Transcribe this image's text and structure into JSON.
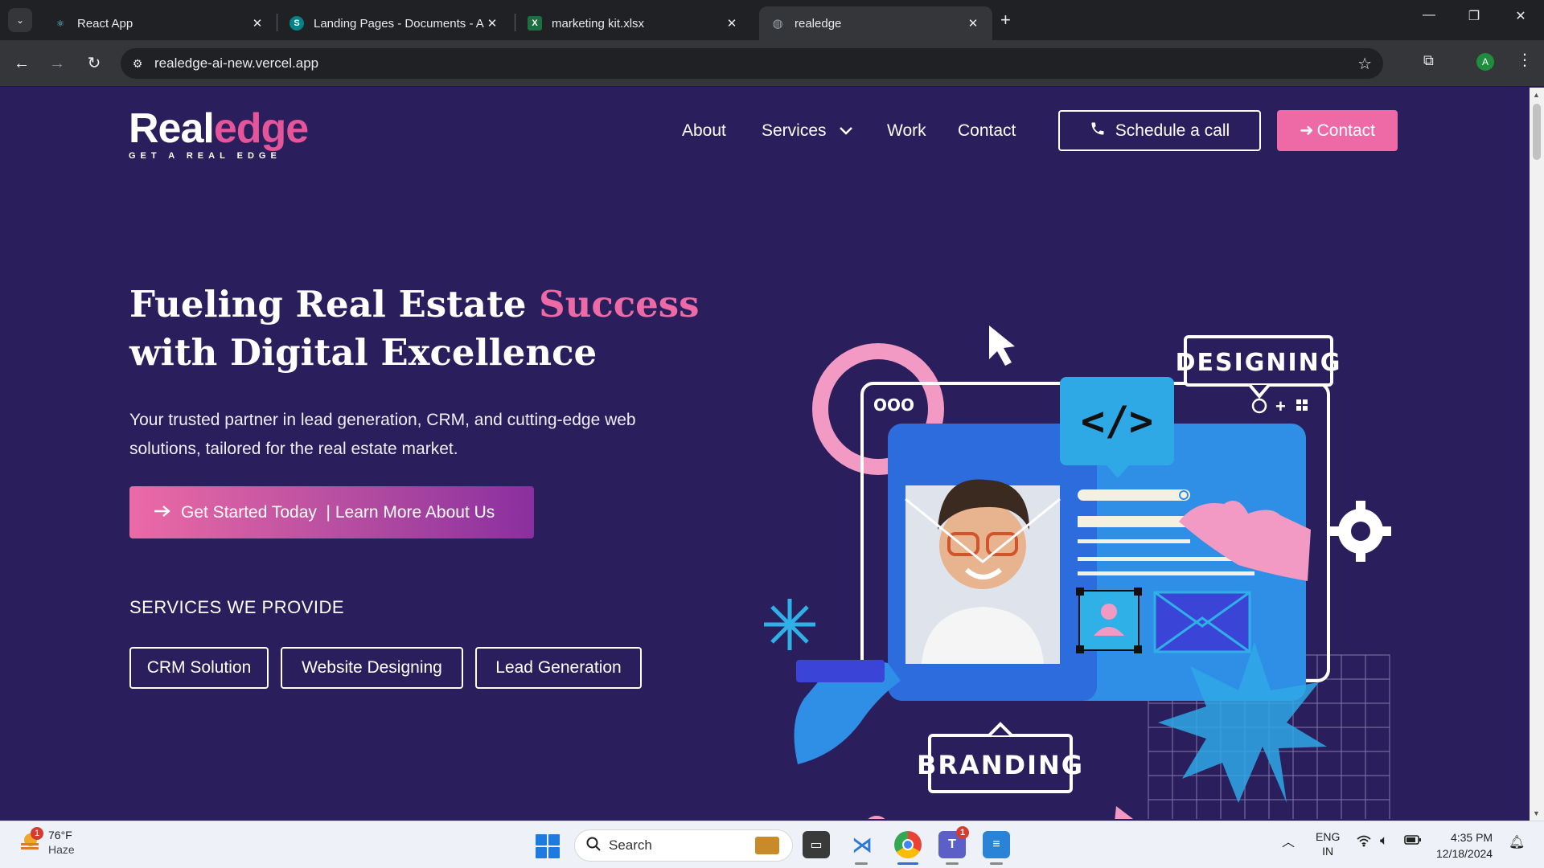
{
  "browser": {
    "tabs": [
      {
        "title": "React App",
        "favicon": "react-icon",
        "active": false
      },
      {
        "title": "Landing Pages - Documents - A",
        "favicon": "sharepoint-icon",
        "active": false
      },
      {
        "title": "marketing kit.xlsx",
        "favicon": "excel-icon",
        "active": false
      },
      {
        "title": "realedge",
        "favicon": "globe-icon",
        "active": true
      }
    ],
    "url": "realedge-ai-new.vercel.app",
    "profile_initial": "A"
  },
  "site": {
    "logo": {
      "part1": "Real",
      "part2": "edge",
      "tagline": "GET A REAL EDGE"
    },
    "nav": {
      "about": "About",
      "services": "Services",
      "work": "Work",
      "contact": "Contact"
    },
    "schedule_label": "Schedule a call",
    "contact_label": "Contact",
    "hero": {
      "title_part1": "Fueling Real Estate ",
      "title_accent": "Success",
      "title_part2": "with Digital Excellence",
      "subtitle": "Your trusted partner in lead generation, CRM, and cutting-edge web solutions, tailored for the real estate market.",
      "cta_label": "Get Started Today  | Learn More About Us"
    },
    "services_heading": "SERVICES WE PROVIDE",
    "services": [
      "CRM Solution",
      "Website Designing",
      "Lead Generation"
    ],
    "art": {
      "designing_label": "DESIGNING",
      "branding_label": "BRANDING",
      "code_label": "</>",
      "dots_label": "OOO"
    }
  },
  "taskbar": {
    "weather": {
      "temp": "76°F",
      "condition": "Haze",
      "badge": "1"
    },
    "search_placeholder": "Search",
    "teams_badge": "1",
    "language": {
      "line1": "ENG",
      "line2": "IN"
    },
    "time": "4:35 PM",
    "date": "12/18/2024"
  },
  "colors": {
    "page_bg": "#2a1f5c",
    "accent_pink": "#ee6aa7",
    "chrome_dark": "#202124"
  }
}
